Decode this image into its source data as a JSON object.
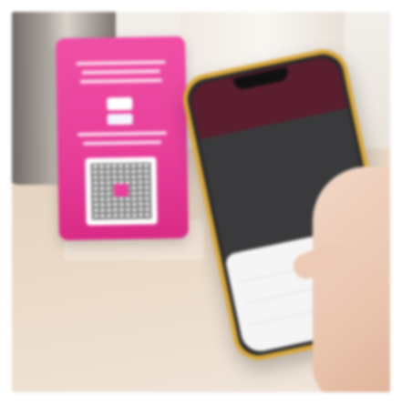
{
  "scene": {
    "description_tags": [
      "kettle-shape",
      "vase-shape",
      "payment-card-stand",
      "phone",
      "hand"
    ],
    "card_color": "#e8409b",
    "phone_frame_color": "#d8a73a",
    "phone_header_color": "#5a1e2e"
  }
}
